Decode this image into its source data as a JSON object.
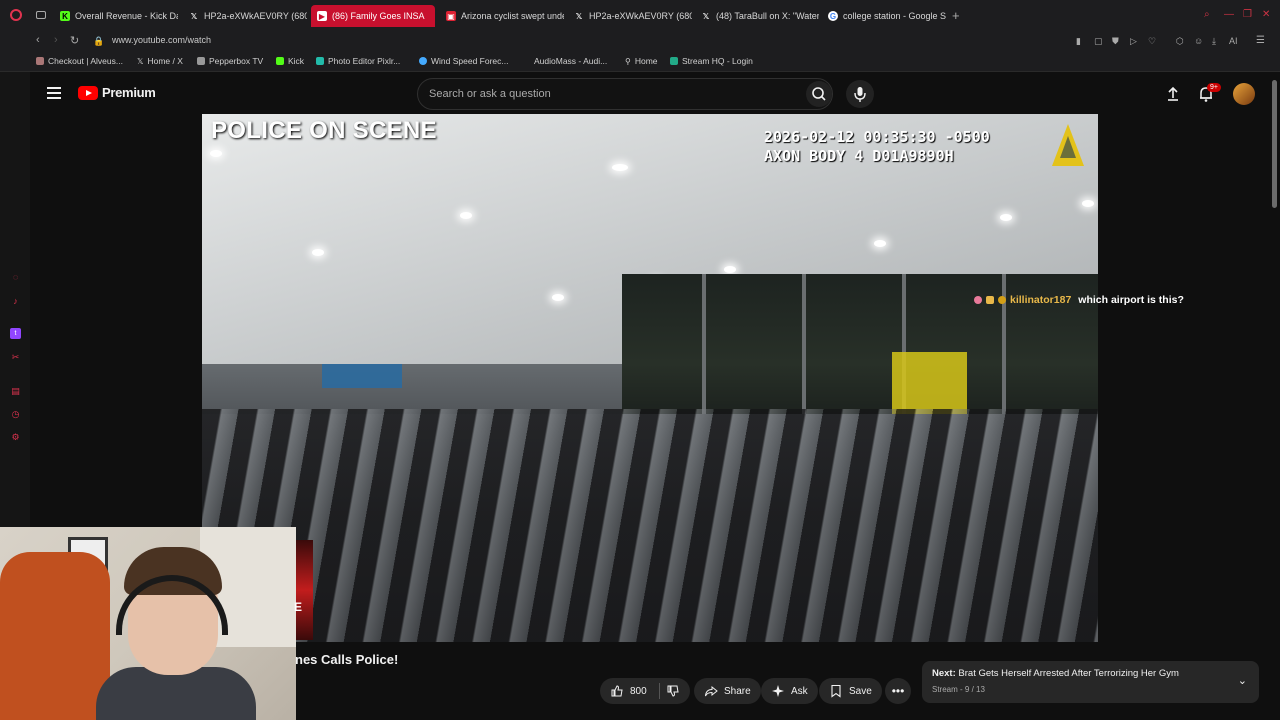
{
  "browser": {
    "tabs": [
      {
        "label": "Overall Revenue - Kick Da",
        "icon": "kick-icon",
        "active": false
      },
      {
        "label": "HP2a-eXWkAEV0RY (680×",
        "icon": "x-icon",
        "active": false
      },
      {
        "label": "(86) Family Goes INSA",
        "icon": "youtube-icon",
        "active": true
      },
      {
        "label": "Arizona cyclist swept unde",
        "icon": "news-icon",
        "active": false
      },
      {
        "label": "HP2a-eXWkAEV0RY (680×",
        "icon": "x-icon",
        "active": false
      },
      {
        "label": "(48) TaraBull on X: \"Water",
        "icon": "x-icon",
        "active": false
      },
      {
        "label": "college station - Google Se",
        "icon": "google-icon",
        "active": false
      }
    ],
    "url": "www.youtube.com/watch",
    "bookmarks": [
      {
        "label": "Checkout | Alveus..."
      },
      {
        "label": "Home / X"
      },
      {
        "label": "Pepperbox TV"
      },
      {
        "label": "Kick"
      },
      {
        "label": "Photo Editor Pixlr..."
      },
      {
        "label": "Wind Speed Forec..."
      },
      {
        "label": "AudioMass - Audi..."
      },
      {
        "label": "Home"
      },
      {
        "label": "Stream HQ - Login"
      }
    ],
    "ai_label": "AI"
  },
  "youtube": {
    "logo_text": "Premium",
    "search_placeholder": "Search or ask a question",
    "notification_count": "9+"
  },
  "video": {
    "overlay_title": "POLICE ON SCENE",
    "timestamp_line1": "2026-02-12 00:35:30 -0500",
    "timestamp_line2": "AXON BODY 4 D01A9890H",
    "title_partial": "nes Calls Police!"
  },
  "chat": {
    "username": "killinator187",
    "message": "which airport is this?"
  },
  "actions": {
    "like_count": "800",
    "share_label": "Share",
    "ask_label": "Ask",
    "save_label": "Save"
  },
  "next_up": {
    "prefix": "Next:",
    "title": "Brat Gets Herself Arrested After Terrorizing Her Gym",
    "subtitle": "Stream - 9 / 13"
  },
  "colors": {
    "accent": "#ff0000",
    "tab_active": "#c8102e",
    "chat_username": "#e8b84a",
    "axon_yellow": "#e3c21a"
  }
}
